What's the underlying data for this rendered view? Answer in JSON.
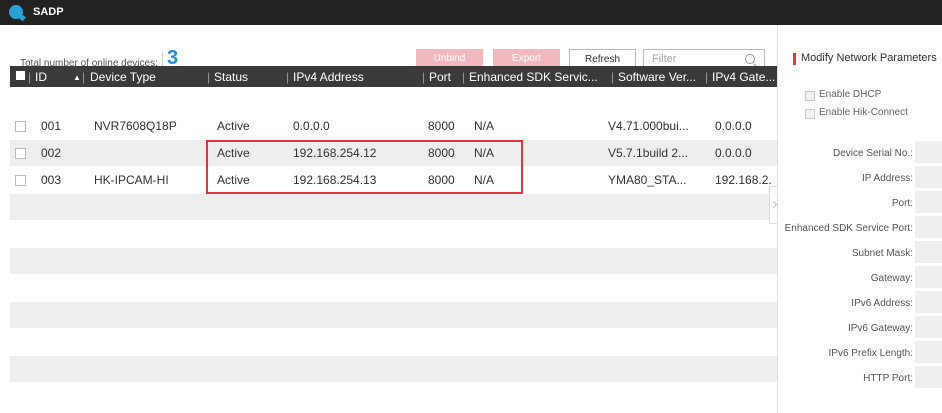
{
  "app": {
    "title": "SADP"
  },
  "summary": {
    "label": "Total number of online devices:",
    "count": "3"
  },
  "toolbar": {
    "unbind": "Unbind",
    "export": "Export",
    "refresh": "Refresh",
    "filter_placeholder": "Filter"
  },
  "table": {
    "headers": {
      "id": "ID",
      "device_type": "Device Type",
      "status": "Status",
      "ipv4": "IPv4 Address",
      "port": "Port",
      "sdk": "Enhanced SDK Servic...",
      "software": "Software Ver...",
      "gateway": "IPv4 Gate..."
    },
    "sort_indicator": "▲",
    "rows": [
      {
        "id": "001",
        "device_type": "NVR7608Q18P",
        "status": "Active",
        "ipv4": "0.0.0.0",
        "port": "8000",
        "sdk": "N/A",
        "software": "V4.71.000bui...",
        "gateway": "0.0.0.0"
      },
      {
        "id": "002",
        "device_type": "",
        "status": "Active",
        "ipv4": "192.168.254.12",
        "port": "8000",
        "sdk": "N/A",
        "software": "V5.7.1build 2...",
        "gateway": "0.0.0.0"
      },
      {
        "id": "003",
        "device_type": "HK-IPCAM-HI",
        "status": "Active",
        "ipv4": "192.168.254.13",
        "port": "8000",
        "sdk": "N/A",
        "software": "YMA80_STA...",
        "gateway": "192.168.2."
      }
    ]
  },
  "panel": {
    "title": "Modify Network Parameters",
    "enable_dhcp": "Enable DHCP",
    "enable_hik_connect": "Enable Hik-Connect",
    "fields": {
      "serial": "Device Serial No.:",
      "ip": "IP Address:",
      "port": "Port:",
      "sdk_port": "Enhanced SDK Service Port:",
      "subnet": "Subnet Mask:",
      "gateway": "Gateway:",
      "ipv6": "IPv6 Address:",
      "ipv6_gateway": "IPv6 Gateway:",
      "ipv6_prefix": "IPv6 Prefix Length:",
      "http_port": "HTTP Port:"
    }
  },
  "colors": {
    "accent": "#2a8fd8",
    "highlight": "#e0353f",
    "header_bg": "#3a3a3a",
    "titlebar_bg": "#222222"
  },
  "icons": {
    "app": "sadp-logo-icon",
    "search": "search-icon",
    "collapse": "chevron-right-icon"
  }
}
